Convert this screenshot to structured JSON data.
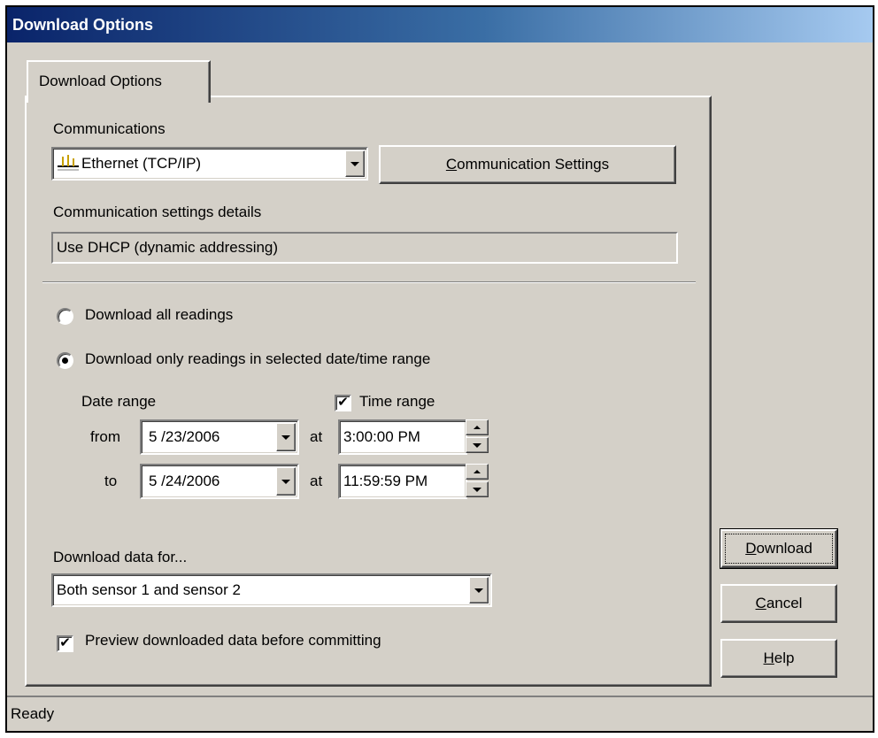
{
  "window": {
    "title": "Download Options"
  },
  "tab": {
    "label": "Download Options"
  },
  "communications": {
    "label": "Communications",
    "selected": "Ethernet (TCP/IP)",
    "icon": "network-icon",
    "settings_button": {
      "prefix": "",
      "mnemonic": "C",
      "rest": "ommunication Settings"
    },
    "details_label": "Communication settings details",
    "details_value": "Use DHCP (dynamic addressing)"
  },
  "download_mode": {
    "all_label": "Download all readings",
    "range_label": "Download only readings in selected date/time range",
    "selected": "range"
  },
  "range": {
    "date_range_label": "Date range",
    "time_range_label": "Time range",
    "time_range_checked": true,
    "from_label": "from",
    "to_label": "to",
    "at_label": "at",
    "from_date": "5 /23/2006",
    "to_date": "5 /24/2006",
    "from_time": "3:00:00 PM",
    "to_time": "11:59:59 PM"
  },
  "download_for": {
    "label": "Download data for...",
    "selected": "Both sensor 1 and sensor 2"
  },
  "preview": {
    "label": "Preview downloaded data before committing",
    "checked": true,
    "check_glyph": "✔"
  },
  "buttons": {
    "download": {
      "mnemonic": "D",
      "rest": "ownload"
    },
    "cancel": {
      "mnemonic": "C",
      "rest": "ancel"
    },
    "help": {
      "mnemonic": "H",
      "rest": "elp"
    }
  },
  "status": {
    "text": "Ready"
  },
  "colors": {
    "face": "#d4d0c8",
    "title_start": "#0a246a",
    "title_end": "#a6caf0"
  }
}
